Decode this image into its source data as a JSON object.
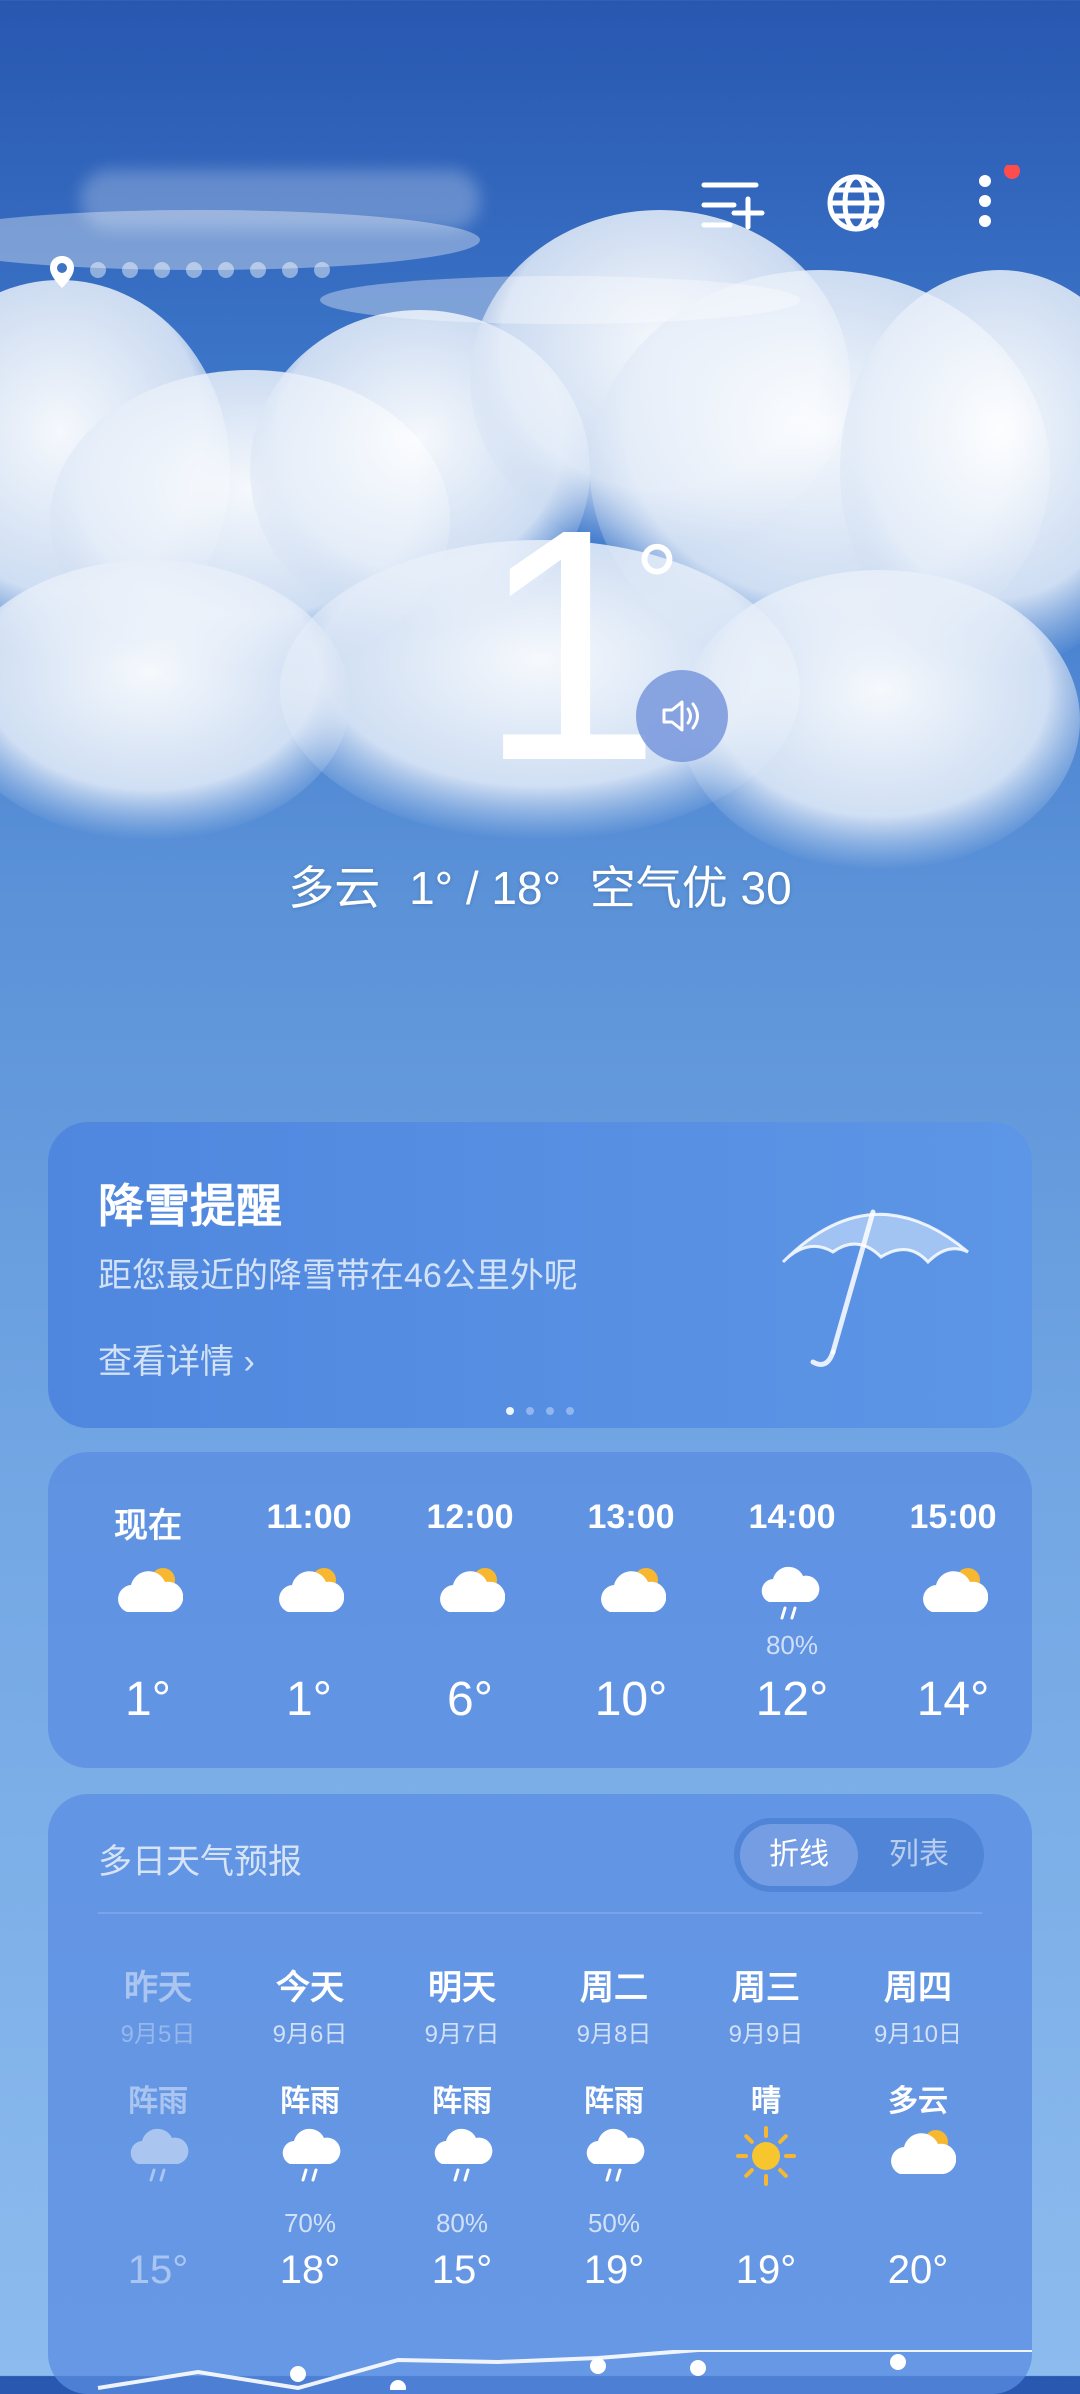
{
  "header": {
    "location_icon": "location-pin-icon",
    "actions": [
      {
        "icon": "add-city-icon"
      },
      {
        "icon": "globe-icon"
      },
      {
        "icon": "more-menu-icon",
        "badge_color": "#ff4d4d"
      }
    ]
  },
  "current": {
    "temperature": "1",
    "degree": "°",
    "condition": "多云",
    "range": "1° / 18°",
    "air": "空气优 30"
  },
  "alert": {
    "title": "降雪提醒",
    "description": "距您最近的降雪带在46公里外呢",
    "link": "查看详情",
    "link_chevron": "›"
  },
  "hourly": [
    {
      "time": "现在",
      "icon": "partly-cloudy-icon",
      "pop": "",
      "temp": "1°"
    },
    {
      "time": "11:00",
      "icon": "partly-cloudy-icon",
      "pop": "",
      "temp": "1°"
    },
    {
      "time": "12:00",
      "icon": "partly-cloudy-icon",
      "pop": "",
      "temp": "6°"
    },
    {
      "time": "13:00",
      "icon": "partly-cloudy-icon",
      "pop": "",
      "temp": "10°"
    },
    {
      "time": "14:00",
      "icon": "rain-icon",
      "pop": "80%",
      "temp": "12°"
    },
    {
      "time": "15:00",
      "icon": "partly-cloudy-icon",
      "pop": "",
      "temp": "14°"
    }
  ],
  "daily": {
    "title": "多日天气预报",
    "toggle": {
      "selected": "折线",
      "other": "列表"
    },
    "days": [
      {
        "day": "昨天",
        "date": "9月5日",
        "weather": "阵雨",
        "icon": "rain-icon",
        "pop": "",
        "high": "15°"
      },
      {
        "day": "今天",
        "date": "9月6日",
        "weather": "阵雨",
        "icon": "rain-icon",
        "pop": "70%",
        "high": "18°"
      },
      {
        "day": "明天",
        "date": "9月7日",
        "weather": "阵雨",
        "icon": "rain-icon",
        "pop": "80%",
        "high": "15°"
      },
      {
        "day": "周二",
        "date": "9月8日",
        "weather": "阵雨",
        "icon": "rain-icon",
        "pop": "50%",
        "high": "19°"
      },
      {
        "day": "周三",
        "date": "9月9日",
        "weather": "晴",
        "icon": "sunny-icon",
        "pop": "",
        "high": "19°"
      },
      {
        "day": "周四",
        "date": "9月10日",
        "weather": "多云",
        "icon": "partly-cloudy-icon",
        "pop": "",
        "high": "20°"
      }
    ]
  }
}
